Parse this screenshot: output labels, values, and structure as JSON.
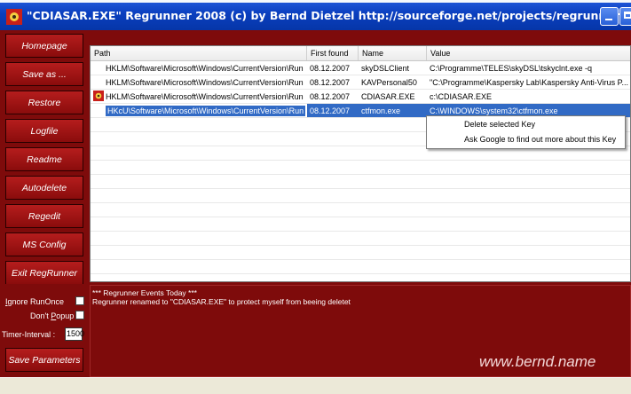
{
  "window": {
    "title": "\"CDIASAR.EXE\"   Regrunner 2008  (c) by Bernd Dietzel    http://sourceforge.net/projects/regrunner"
  },
  "nav": [
    {
      "label": "Homepage"
    },
    {
      "label": "Save as ..."
    },
    {
      "label": "Restore"
    },
    {
      "label": "Logfile"
    },
    {
      "label": "Readme"
    },
    {
      "label": "Autodelete"
    },
    {
      "label": "Regedit"
    },
    {
      "label": "MS Config"
    },
    {
      "label": "Exit RegRunner"
    }
  ],
  "table": {
    "columns": [
      "Path",
      "First found",
      "Name",
      "Value"
    ],
    "rows": [
      {
        "path": "HKLM\\Software\\Microsoft\\Windows\\CurrentVersion\\Run",
        "first_found": "08.12.2007",
        "name": "skyDSLClient",
        "value": "C:\\Programme\\TELES\\skyDSL\\tskyclnt.exe -q",
        "has_icon": false
      },
      {
        "path": "HKLM\\Software\\Microsoft\\Windows\\CurrentVersion\\Run",
        "first_found": "08.12.2007",
        "name": "KAVPersonal50",
        "value": "\"C:\\Programme\\Kaspersky Lab\\Kaspersky Anti-Virus P...",
        "has_icon": false
      },
      {
        "path": "HKLM\\Software\\Microsoft\\Windows\\CurrentVersion\\Run",
        "first_found": "08.12.2007",
        "name": "CDIASAR.EXE",
        "value": "c:\\CDIASAR.EXE",
        "has_icon": true
      },
      {
        "path": "HKcU\\Software\\Microsoft\\Windows\\CurrentVersion\\Run",
        "first_found": "08.12.2007",
        "name": "ctfmon.exe",
        "value": "C:\\WINDOWS\\system32\\ctfmon.exe",
        "has_icon": false,
        "selected": true
      }
    ]
  },
  "context_menu": {
    "items": [
      "Delete selected Key",
      "Ask Google to find out more about this Key"
    ]
  },
  "options": {
    "ignore_runonce": {
      "pre": "I",
      "rest": "gnore RunOnce",
      "checked": false
    },
    "dont_popup": {
      "pre": "Don't ",
      "ul": "P",
      "rest": "opup",
      "checked": false
    },
    "timer_label": "Timer-Interval :",
    "timer_value": "1500",
    "save_label": "Save Parameters"
  },
  "events": {
    "header": "*** Regrunner Events Today ***",
    "lines": [
      "Regrunner renamed to \"CDIASAR.EXE\" to protect myself from beeing deletet"
    ]
  },
  "website": "www.bernd.name",
  "colors": {
    "panel": "#7e0b0b",
    "button": "#a81818",
    "titlebar": "#0a3fbe",
    "selection": "#316ac5"
  }
}
